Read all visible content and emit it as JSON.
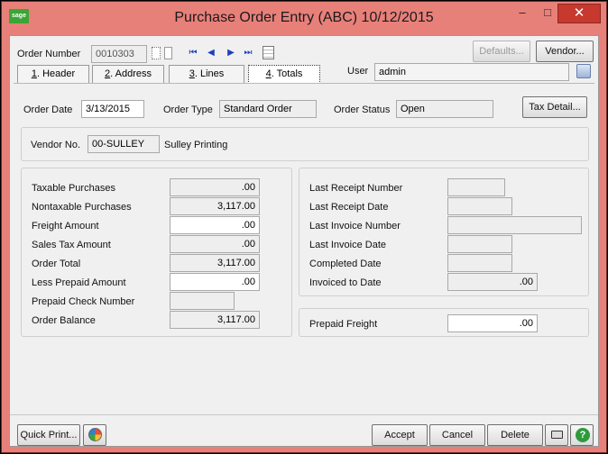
{
  "window": {
    "title": "Purchase Order Entry (ABC) 10/12/2015",
    "logo_text": "sage",
    "min_glyph": "–",
    "max_glyph": "□",
    "close_glyph": "✕"
  },
  "header": {
    "order_number_label": "Order Number",
    "order_number_value": "0010303",
    "defaults_label": "Defaults...",
    "vendor_label": "Vendor...",
    "user_label": "User",
    "user_value": "admin"
  },
  "nav": {
    "first": "⏮",
    "prev": "◀",
    "next": "▶",
    "last": "⏭"
  },
  "tabs": [
    {
      "num": "1",
      "label": ". Header"
    },
    {
      "num": "2",
      "label": ". Address"
    },
    {
      "num": "3",
      "label": ". Lines"
    },
    {
      "num": "4",
      "label": ". Totals"
    }
  ],
  "order": {
    "order_date_label": "Order Date",
    "order_date_value": "3/13/2015",
    "order_type_label": "Order Type",
    "order_type_value": "Standard Order",
    "order_status_label": "Order Status",
    "order_status_value": "Open",
    "tax_detail_label": "Tax Detail..."
  },
  "vendor": {
    "vendor_no_label": "Vendor No.",
    "vendor_no_value": "00-SULLEY",
    "vendor_name": "Sulley Printing"
  },
  "totals": {
    "taxable_label": "Taxable Purchases",
    "taxable_value": ".00",
    "nontaxable_label": "Nontaxable Purchases",
    "nontaxable_value": "3,117.00",
    "freight_label": "Freight Amount",
    "freight_value": ".00",
    "salestax_label": "Sales Tax Amount",
    "salestax_value": ".00",
    "ordertotal_label": "Order Total",
    "ordertotal_value": "3,117.00",
    "prepaid_label": "Less Prepaid Amount",
    "prepaid_value": ".00",
    "prepaid_check_label": "Prepaid Check Number",
    "prepaid_check_value": "",
    "balance_label": "Order Balance",
    "balance_value": "3,117.00"
  },
  "receipts": {
    "last_receipt_number_label": "Last Receipt Number",
    "last_receipt_number_value": "",
    "last_receipt_date_label": "Last Receipt Date",
    "last_receipt_date_value": "",
    "last_invoice_number_label": "Last Invoice Number",
    "last_invoice_number_value": "",
    "last_invoice_date_label": "Last Invoice Date",
    "last_invoice_date_value": "",
    "completed_date_label": "Completed Date",
    "completed_date_value": "",
    "invoiced_label": "Invoiced to Date",
    "invoiced_value": ".00",
    "prepaid_freight_label": "Prepaid Freight",
    "prepaid_freight_value": ".00"
  },
  "footer": {
    "quick_print_label": "Quick Print...",
    "accept_label": "Accept",
    "cancel_label": "Cancel",
    "delete_label": "Delete",
    "help_glyph": "?"
  },
  "colors": {
    "titlebar": "#e8807a",
    "close": "#c7382e",
    "sage_green": "#3aa635",
    "nav_blue": "#1f3fbf"
  }
}
